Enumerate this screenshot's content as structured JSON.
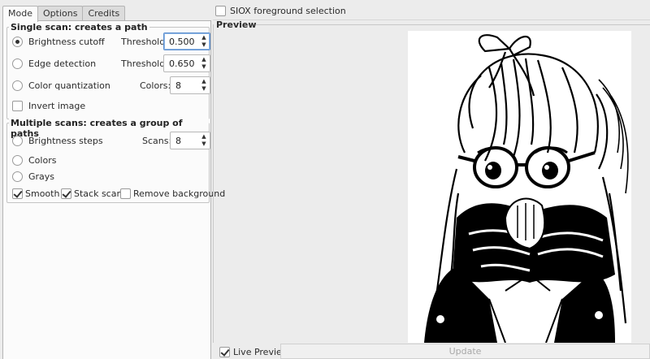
{
  "tabs": [
    "Mode",
    "Options",
    "Credits"
  ],
  "single_scan": {
    "title": "Single scan: creates a path",
    "brightness": {
      "label": "Brightness cutoff",
      "param_label": "Threshold:",
      "value": "0.500"
    },
    "edge": {
      "label": "Edge detection",
      "param_label": "Threshold:",
      "value": "0.650"
    },
    "color_quant": {
      "label": "Color quantization",
      "param_label": "Colors:",
      "value": "8"
    },
    "invert": {
      "label": "Invert image"
    }
  },
  "multiple_scans": {
    "title": "Multiple scans: creates a group of paths",
    "brightness_steps": {
      "label": "Brightness steps",
      "param_label": "Scans:",
      "value": "8"
    },
    "colors": {
      "label": "Colors"
    },
    "grays": {
      "label": "Grays"
    },
    "smooth": {
      "label": "Smooth"
    },
    "stack": {
      "label": "Stack scans"
    },
    "remove_bg": {
      "label": "Remove background"
    }
  },
  "siox": {
    "label": "SIOX foreground selection"
  },
  "preview": {
    "title": "Preview"
  },
  "live_preview": {
    "label": "Live Preview"
  },
  "update_button": {
    "label": "Update"
  }
}
